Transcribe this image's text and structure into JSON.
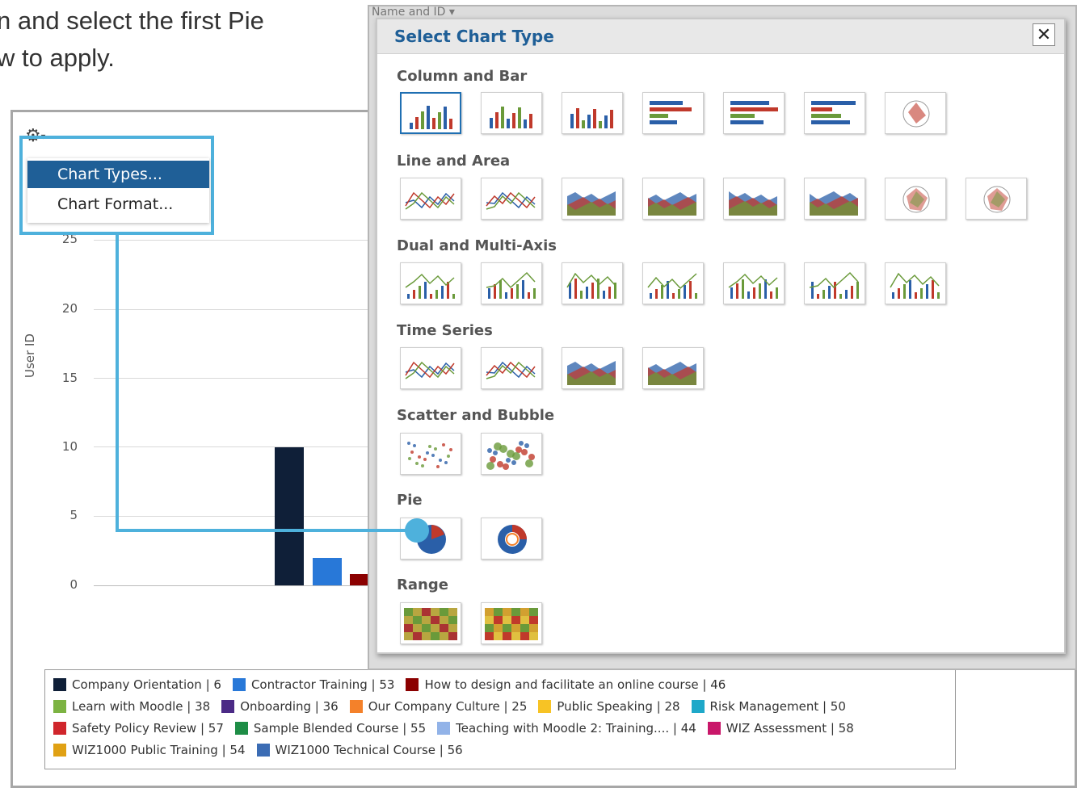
{
  "instructions": {
    "line1": "n and select the first Pie",
    "line2": "w to apply."
  },
  "chart": {
    "y_axis_label": "User ID",
    "y_ticks": [
      "25",
      "20",
      "15",
      "10",
      "5",
      "0"
    ]
  },
  "chart_data": {
    "type": "bar",
    "ylabel": "User ID",
    "ylim": [
      0,
      25
    ],
    "series": [
      {
        "name": "Company Orientation | 6",
        "values": [
          10
        ]
      },
      {
        "name": "Contractor Training | 53",
        "values": [
          2
        ]
      },
      {
        "name": "How to design and facilitate an online course | 46",
        "values": [
          0.8
        ]
      }
    ]
  },
  "legend": {
    "rows": [
      [
        {
          "label": "Company Orientation | 6",
          "color": "#0f1f38"
        },
        {
          "label": "Contractor Training | 53",
          "color": "#2878d8"
        },
        {
          "label": "How to design and facilitate an online course | 46",
          "color": "#8b0000"
        }
      ],
      [
        {
          "label": "Learn with Moodle | 38",
          "color": "#7cb342"
        },
        {
          "label": "Onboarding | 36",
          "color": "#4b2a86"
        },
        {
          "label": "Our Company Culture | 25",
          "color": "#f4812a"
        },
        {
          "label": "Public Speaking | 28",
          "color": "#f7c325"
        },
        {
          "label": "Risk Management | 50",
          "color": "#1ea8c9"
        }
      ],
      [
        {
          "label": "Safety Policy Review | 57",
          "color": "#d0262c"
        },
        {
          "label": "Sample Blended Course | 55",
          "color": "#1e8d46"
        },
        {
          "label": "Teaching with Moodle 2: Training.... | 44",
          "color": "#92b3e8"
        },
        {
          "label": "WIZ Assessment | 58",
          "color": "#c9176a"
        }
      ],
      [
        {
          "label": "WIZ1000 Public Training | 54",
          "color": "#e0a114"
        },
        {
          "label": "WIZ1000 Technical Course | 56",
          "color": "#3b6cb4"
        }
      ]
    ]
  },
  "menu": {
    "items": [
      "Chart Types...",
      "Chart Format..."
    ]
  },
  "background_tab": "Name and ID",
  "dialog": {
    "title": "Select Chart Type",
    "close_label": "✕",
    "sections": [
      {
        "title": "Column and Bar",
        "count": 7
      },
      {
        "title": "Line and Area",
        "count": 8
      },
      {
        "title": "Dual and Multi-Axis",
        "count": 7
      },
      {
        "title": "Time Series",
        "count": 4
      },
      {
        "title": "Scatter and Bubble",
        "count": 2
      },
      {
        "title": "Pie",
        "count": 2
      },
      {
        "title": "Range",
        "count": 2
      }
    ]
  },
  "colors": {
    "accent": "#1f5f97",
    "highlight": "#4eb1dc"
  }
}
